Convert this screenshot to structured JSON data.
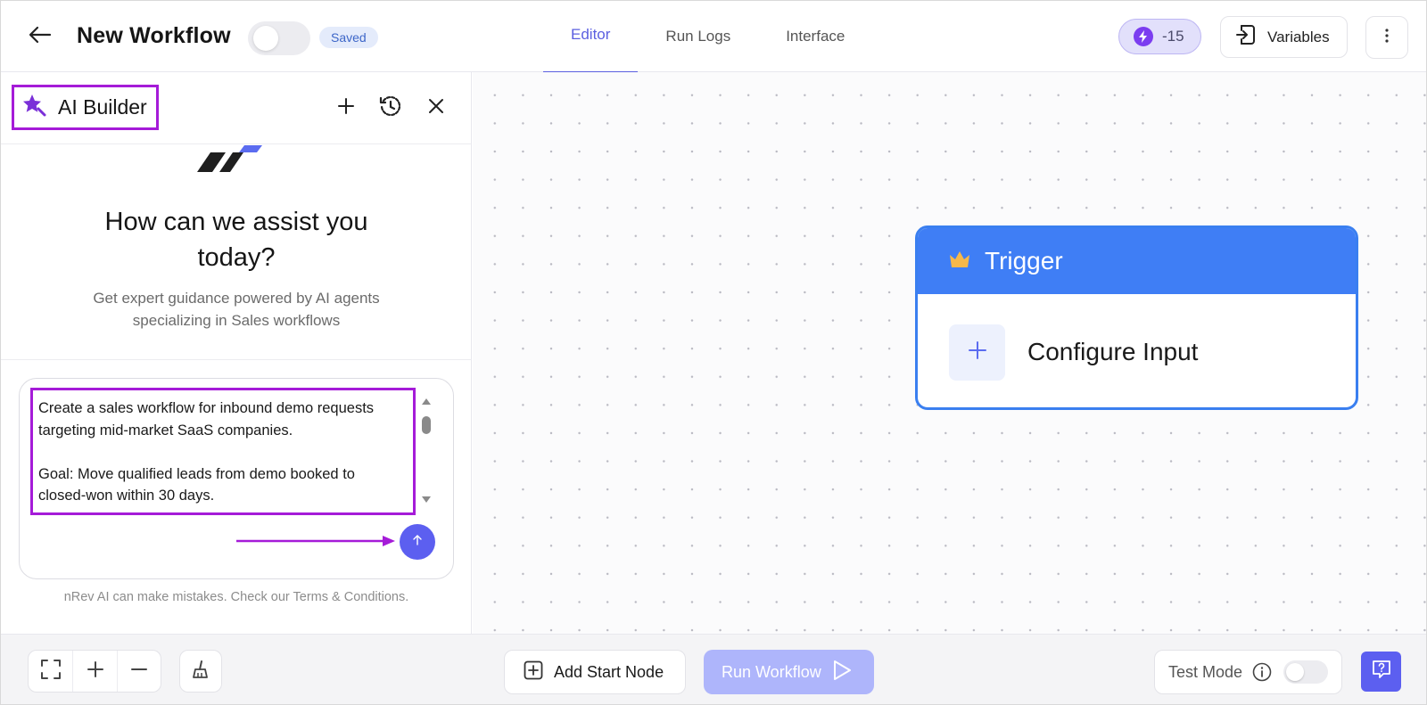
{
  "header": {
    "title": "New Workflow",
    "status_badge": "Saved",
    "tabs": [
      {
        "label": "Editor",
        "active": true
      },
      {
        "label": "Run Logs",
        "active": false
      },
      {
        "label": "Interface",
        "active": false
      }
    ],
    "credits": "-15",
    "variables_label": "Variables",
    "publish_toggle_on": false
  },
  "ai_builder": {
    "title": "AI Builder",
    "assist_title_line1": "How can we assist you",
    "assist_title_line2": "today?",
    "assist_sub_line1": "Get expert guidance powered by AI agents",
    "assist_sub_line2": "specializing in Sales workflows",
    "prompt_lines": [
      "Create a sales workflow for inbound demo requests",
      "targeting mid-market SaaS companies.",
      "",
      "Goal: Move qualified leads from demo booked to",
      "closed-won within 30 days."
    ],
    "disclaimer_prefix": "nRev AI can make mistakes. Check our ",
    "disclaimer_link": "Terms & Conditions",
    "disclaimer_suffix": "."
  },
  "canvas": {
    "trigger_title": "Trigger",
    "configure_label": "Configure Input"
  },
  "bottom_bar": {
    "add_start_label": "Add Start Node",
    "run_label": "Run Workflow",
    "test_mode_label": "Test Mode",
    "test_mode_on": false
  },
  "colors": {
    "accent": "#5b5fe0",
    "annotation": "#a51bd8",
    "trigger_blue": "#3f7ef5",
    "run_disabled": "#aeb5fb"
  },
  "icons": {
    "back": "arrow-left-icon",
    "credits": "lightning-icon",
    "variables": "import-box-icon",
    "more": "vertical-dots-icon",
    "ai_builder": "magic-star-icon",
    "new_chat": "plus-icon",
    "history": "history-icon",
    "close": "close-icon",
    "send": "arrow-up-icon",
    "trigger": "crown-icon",
    "fit": "fit-view-icon",
    "zoom_in": "plus-icon",
    "zoom_out": "minus-icon",
    "clean": "broom-icon",
    "add_node": "plus-square-icon",
    "play": "play-icon",
    "info": "info-icon",
    "help": "help-chat-icon"
  }
}
